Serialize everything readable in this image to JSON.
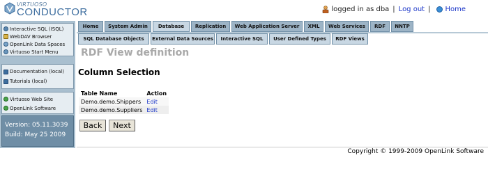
{
  "header": {
    "logo_small": "VIRTUOSO",
    "logo_big": "CONDUCTOR",
    "logged_in_text": "logged in as dba",
    "logout_label": "Log out",
    "home_label": "Home",
    "separator": "|"
  },
  "sidebar": {
    "group1": [
      {
        "label": "Interactive SQL (ISQL)",
        "icon": "isql-icon"
      },
      {
        "label": "WebDAV Browser",
        "icon": "webdav-icon"
      },
      {
        "label": "OpenLink Data Spaces",
        "icon": "ods-icon"
      },
      {
        "label": "Virtuoso Start Menu",
        "icon": "start-menu-icon"
      }
    ],
    "group2": [
      {
        "label": "Documentation (local)",
        "icon": "book-icon"
      },
      {
        "label": "Tutorials (local)",
        "icon": "book-icon"
      }
    ],
    "group3": [
      {
        "label": "Virtuoso Web Site",
        "icon": "globe-icon"
      },
      {
        "label": "OpenLink Software",
        "icon": "globe-icon"
      }
    ],
    "version": "Version: 05.11.3039",
    "build": "Build: May 25 2009"
  },
  "tabs_top": [
    "Home",
    "System Admin",
    "Database",
    "Replication",
    "Web Application Server",
    "XML",
    "Web Services",
    "RDF",
    "NNTP"
  ],
  "tabs_sub": [
    "SQL Database Objects",
    "External Data Sources",
    "Interactive SQL",
    "User Defined Types",
    "RDF Views"
  ],
  "main": {
    "page_title": "RDF View definition",
    "section_title": "Column Selection",
    "table": {
      "headers": [
        "Table Name",
        "Action"
      ],
      "rows": [
        {
          "name": "Demo.demo.Shippers",
          "action": "Edit"
        },
        {
          "name": "Demo.demo.Suppliers",
          "action": "Edit"
        }
      ]
    },
    "back_label": "Back",
    "next_label": "Next"
  },
  "footer": {
    "copyright": "Copyright © 1999-2009 OpenLink Software"
  },
  "colors": {
    "sidebar_bg": "#a9bfcf",
    "tab_bg": "#9db4c6",
    "link": "#1a35c8",
    "version_bg": "#6f8ea6"
  }
}
